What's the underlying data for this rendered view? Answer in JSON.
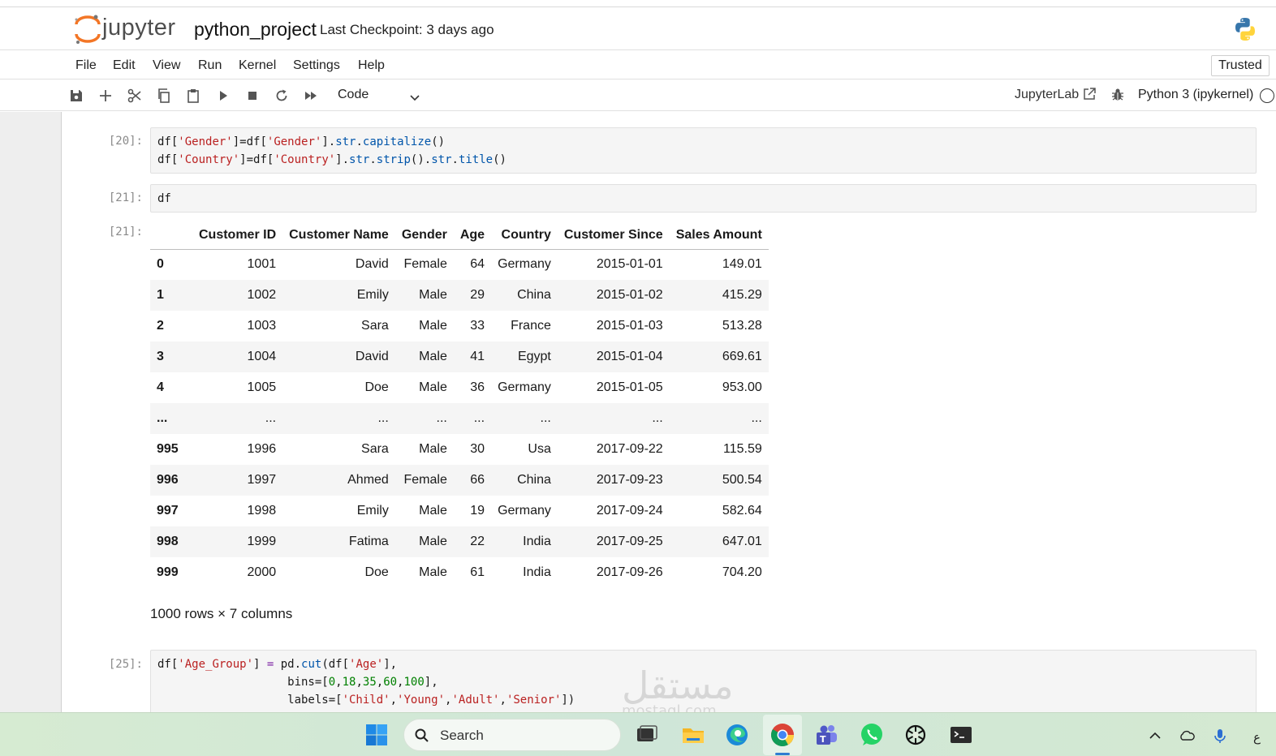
{
  "app": {
    "logo_text": "jupyter",
    "notebook_title": "python_project",
    "checkpoint": "Last Checkpoint: 3 days ago"
  },
  "menu": {
    "items": [
      "File",
      "Edit",
      "View",
      "Run",
      "Kernel",
      "Settings",
      "Help"
    ],
    "trusted": "Trusted"
  },
  "toolbar": {
    "cell_type": "Code",
    "jupyterlab": "JupyterLab",
    "kernel": "Python 3 (ipykernel)"
  },
  "cells": {
    "c20": {
      "prompt": "[20]:",
      "line1": [
        "df[",
        "'Gender'",
        "]=df[",
        "'Gender'",
        "].",
        "str",
        ".",
        "capitalize",
        "()"
      ],
      "line2": [
        "df[",
        "'Country'",
        "]=df[",
        "'Country'",
        "].",
        "str",
        ".",
        "strip",
        "().",
        "str",
        ".",
        "title",
        "()"
      ]
    },
    "c21": {
      "prompt": "[21]:",
      "code": "df",
      "out_prompt": "[21]:"
    },
    "c25": {
      "prompt": "[25]:",
      "line1": [
        "df[",
        "'Age_Group'",
        "] ",
        "=",
        " pd.",
        "cut",
        "(df[",
        "'Age'",
        "],"
      ],
      "line2": [
        "                   bins=[",
        "0",
        ",",
        "18",
        ",",
        "35",
        ",",
        "60",
        ",",
        "100",
        "],"
      ],
      "line3": [
        "                   labels=[",
        "'Child'",
        ",",
        "'Young'",
        ",",
        "'Adult'",
        ",",
        "'Senior'",
        "])"
      ]
    }
  },
  "dataframe": {
    "columns": [
      "",
      "Customer ID",
      "Customer Name",
      "Gender",
      "Age",
      "Country",
      "Customer Since",
      "Sales Amount"
    ],
    "rows": [
      [
        "0",
        "1001",
        "David",
        "Female",
        "64",
        "Germany",
        "2015-01-01",
        "149.01"
      ],
      [
        "1",
        "1002",
        "Emily",
        "Male",
        "29",
        "China",
        "2015-01-02",
        "415.29"
      ],
      [
        "2",
        "1003",
        "Sara",
        "Male",
        "33",
        "France",
        "2015-01-03",
        "513.28"
      ],
      [
        "3",
        "1004",
        "David",
        "Male",
        "41",
        "Egypt",
        "2015-01-04",
        "669.61"
      ],
      [
        "4",
        "1005",
        "Doe",
        "Male",
        "36",
        "Germany",
        "2015-01-05",
        "953.00"
      ],
      [
        "...",
        "...",
        "...",
        "...",
        "...",
        "...",
        "...",
        "..."
      ],
      [
        "995",
        "1996",
        "Sara",
        "Male",
        "30",
        "Usa",
        "2017-09-22",
        "115.59"
      ],
      [
        "996",
        "1997",
        "Ahmed",
        "Female",
        "66",
        "China",
        "2017-09-23",
        "500.54"
      ],
      [
        "997",
        "1998",
        "Emily",
        "Male",
        "19",
        "Germany",
        "2017-09-24",
        "582.64"
      ],
      [
        "998",
        "1999",
        "Fatima",
        "Male",
        "22",
        "India",
        "2017-09-25",
        "647.01"
      ],
      [
        "999",
        "2000",
        "Doe",
        "Male",
        "61",
        "India",
        "2017-09-26",
        "704.20"
      ]
    ],
    "shape": "1000 rows × 7 columns"
  },
  "watermark": {
    "text": "مستقل",
    "sub": "mostaql.com"
  },
  "taskbar": {
    "search": "Search",
    "lang": "ع",
    "apps": [
      "windows-start",
      "file-explorer",
      "folder",
      "edge",
      "chrome",
      "teams",
      "whatsapp",
      "chatgpt",
      "terminal"
    ]
  },
  "colors": {
    "string": "#ba2121",
    "builtin": "#0055aa",
    "number": "#008000",
    "jupyter_orange": "#f37626"
  }
}
